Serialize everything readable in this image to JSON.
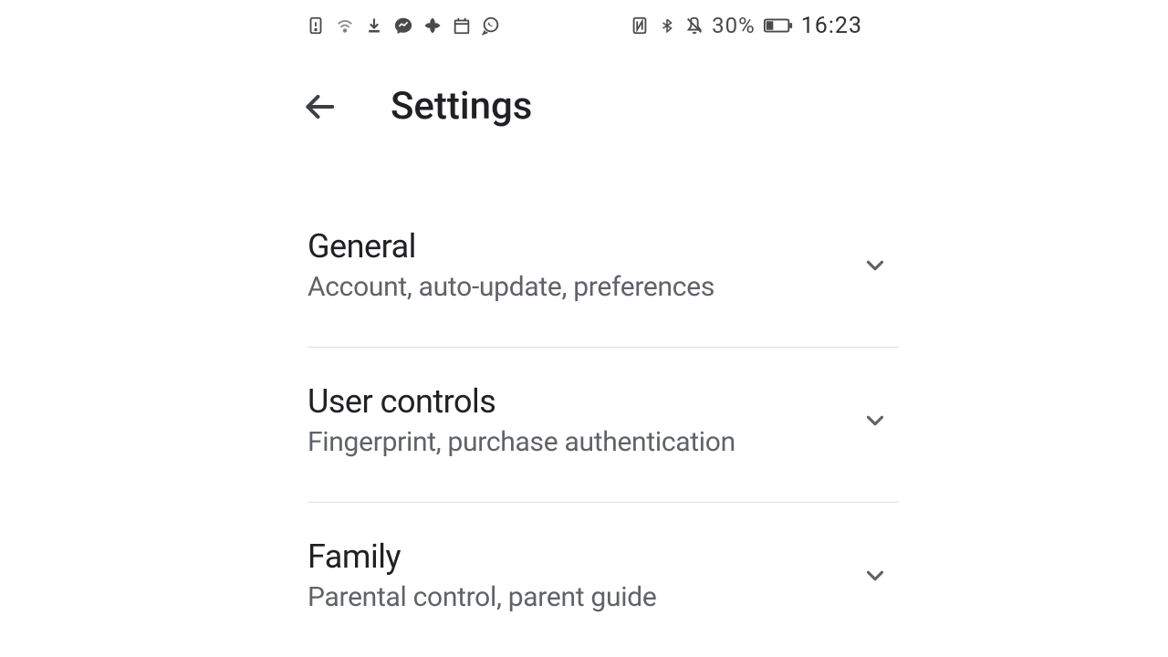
{
  "status_bar": {
    "battery_percent": "30%",
    "time": "16:23"
  },
  "header": {
    "title": "Settings"
  },
  "settings": {
    "items": [
      {
        "title": "General",
        "subtitle": "Account, auto-update, preferences"
      },
      {
        "title": "User controls",
        "subtitle": "Fingerprint, purchase authentication"
      },
      {
        "title": "Family",
        "subtitle": "Parental control, parent guide"
      }
    ]
  }
}
